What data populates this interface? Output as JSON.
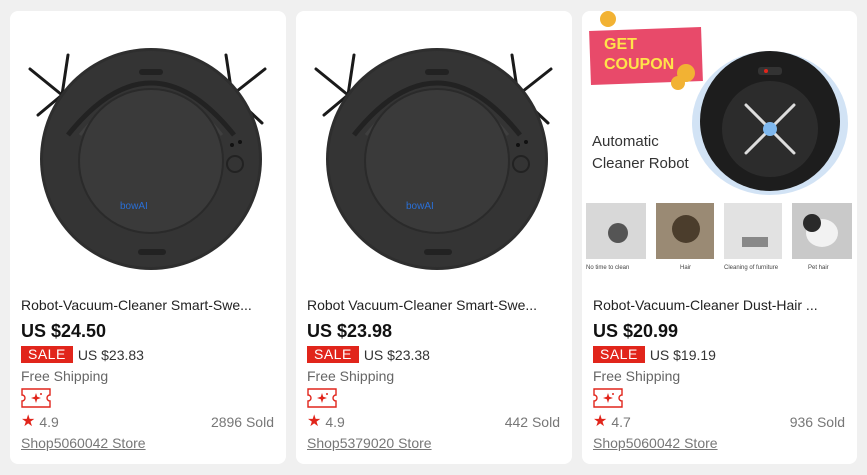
{
  "products": [
    {
      "title": "Robot-Vacuum-Cleaner Smart-Swe...",
      "price": "US $24.50",
      "sale_label": "SALE",
      "sale_price": "US $23.83",
      "shipping": "Free Shipping",
      "rating": "4.9",
      "sold": "2896 Sold",
      "store": "Shop5060042 Store"
    },
    {
      "title": "Robot Vacuum-Cleaner Smart-Swe...",
      "price": "US $23.98",
      "sale_label": "SALE",
      "sale_price": "US $23.38",
      "shipping": "Free Shipping",
      "rating": "4.9",
      "sold": "442 Sold",
      "store": "Shop5379020 Store"
    },
    {
      "title": "Robot-Vacuum-Cleaner Dust-Hair ...",
      "price": "US $20.99",
      "sale_label": "SALE",
      "sale_price": "US $19.19",
      "shipping": "Free Shipping",
      "rating": "4.7",
      "sold": "936 Sold",
      "store": "Shop5060042 Store",
      "promo": {
        "coupon_line1": "GET",
        "coupon_line2": "COUPON",
        "headline_line1": "Automatic",
        "headline_line2": "Cleaner Robot",
        "captions": [
          "No time to clean",
          "Hair",
          "Cleaning of furniture",
          "Pet hair"
        ]
      }
    }
  ],
  "colors": {
    "accent": "#e1251b",
    "background": "#f0f0f0",
    "card": "#ffffff"
  },
  "icons": {
    "rating": "star-icon",
    "coupon": "coupon-icon"
  }
}
